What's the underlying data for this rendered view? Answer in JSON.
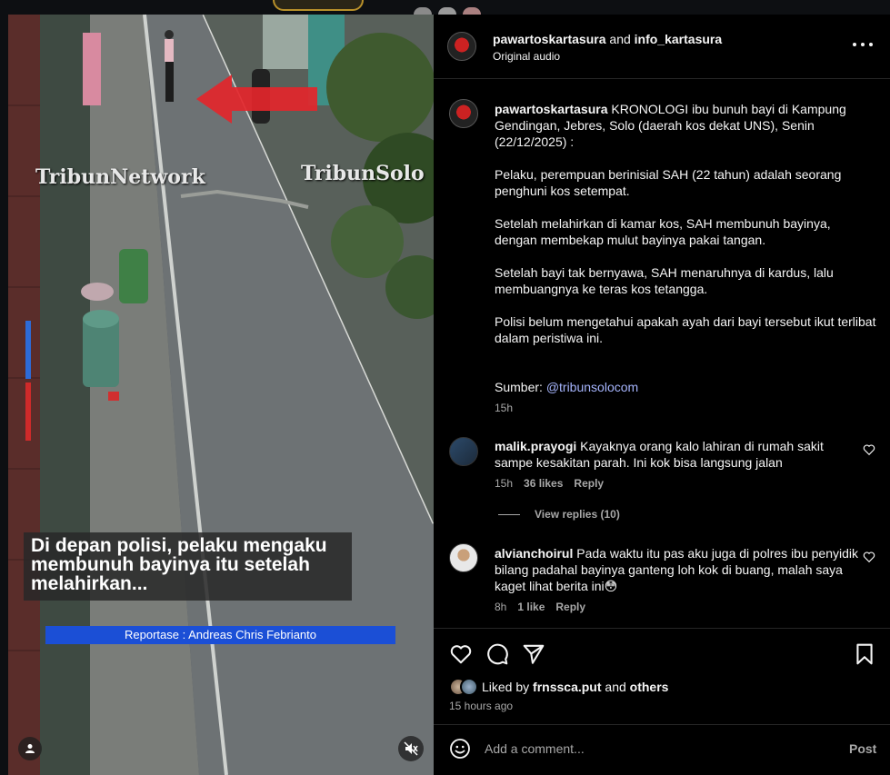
{
  "video": {
    "watermark_left": "TribunNetwork",
    "watermark_right": "TribunSolo",
    "caption_lines": [
      "Di depan polisi, pelaku mengaku",
      "membunuh bayinya itu setelah",
      "melahirkan..."
    ],
    "reportase": "Reportase : Andreas Chris Febrianto"
  },
  "post": {
    "header": {
      "author1": "pawartoskartasura",
      "joiner": "and",
      "author2": "info_kartasura",
      "audio": "Original audio"
    },
    "caption": {
      "username": "pawartoskartasura",
      "paragraphs": [
        "KRONOLOGI ibu bunuh bayi di Kampung Gendingan, Jebres, Solo (daerah kos dekat UNS), Senin (22/12/2025) :",
        "Pelaku, perempuan berinisial SAH (22 tahun) adalah seorang penghuni kos setempat.",
        "Setelah melahirkan di kamar kos, SAH membunuh bayinya, dengan membekap mulut bayinya pakai tangan.",
        "Setelah bayi tak bernyawa, SAH menaruhnya di kardus, lalu membuangnya ke teras kos tetangga.",
        "Polisi belum mengetahui apakah ayah dari bayi tersebut ikut terlibat dalam peristiwa ini."
      ],
      "source_label": "Sumber:",
      "source_link": "@tribunsolocom",
      "time": "15h"
    },
    "comments": [
      {
        "username": "malik.prayogi",
        "text": "Kayaknya orang kalo lahiran di rumah sakit sampe kesakitan parah. Ini kok bisa langsung jalan",
        "time": "15h",
        "likes": "36 likes",
        "reply": "Reply",
        "view_replies": "View replies (10)"
      },
      {
        "username": "alvianchoirul",
        "text": "Pada waktu itu pas aku juga di polres ibu penyidik bilang padahal bayinya ganteng loh kok di buang, malah saya kaget lihat berita ini😳",
        "time": "8h",
        "likes": "1 like",
        "reply": "Reply"
      }
    ],
    "likes": {
      "prefix": "Liked by",
      "user": "frnssca.put",
      "joiner": "and",
      "others": "others"
    },
    "time_ago": "15 hours ago",
    "comment_box": {
      "placeholder": "Add a comment...",
      "post_label": "Post"
    }
  },
  "icons": [
    "more-icon",
    "heart-icon",
    "comment-icon",
    "share-icon",
    "bookmark-icon",
    "emoji-icon",
    "user-icon",
    "mute-icon",
    "arrow-icon"
  ],
  "colors": {
    "panel_bg": "#000000",
    "text": "#f5f5f5",
    "muted": "#a8a8a8",
    "link": "#a5b4fc",
    "reportase_bg": "#1b4fd6",
    "arrow_red": "#e3262b"
  }
}
